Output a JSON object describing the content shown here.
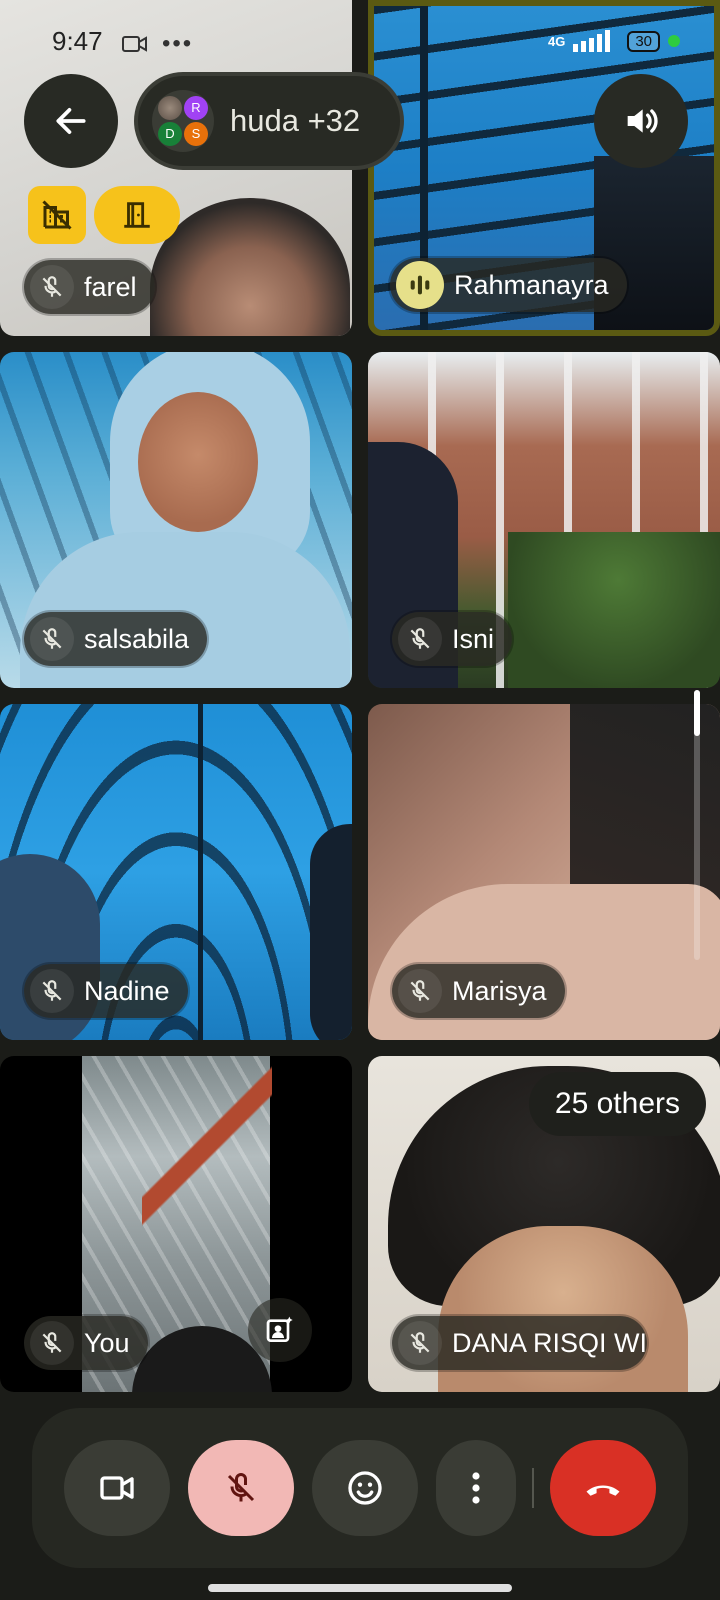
{
  "status_bar": {
    "time": "9:47",
    "network": "4G",
    "battery": "30"
  },
  "header": {
    "back_icon": "arrow-left-icon",
    "meeting_title": "huda +32",
    "avatar_letters": [
      "R",
      "D",
      "S"
    ],
    "speaker_icon": "speaker-icon",
    "privacy_chips": [
      "building-off-icon",
      "door-icon"
    ]
  },
  "participants": [
    {
      "name": "farel",
      "muted": true
    },
    {
      "name": "Rahmanayra",
      "speaking": true
    },
    {
      "name": "salsabila",
      "muted": true
    },
    {
      "name": "Isni",
      "muted": true
    },
    {
      "name": "Nadine",
      "muted": true
    },
    {
      "name": "Marisya",
      "muted": true
    },
    {
      "name": "You",
      "muted": true
    },
    {
      "name": "DANA RISQI WI",
      "muted": true
    }
  ],
  "others_badge": "25 others",
  "controls": {
    "camera": "camera-icon",
    "mic": "mic-off-icon",
    "reactions": "emoji-icon",
    "more": "more-vert-icon",
    "end_call": "end-call-icon"
  },
  "colors": {
    "background": "#1b1c18",
    "accent_yellow": "#f6c21b",
    "end_call_red": "#d93025",
    "mic_off_pink": "#f2b8b5",
    "speaker_border": "#5b5a12"
  }
}
